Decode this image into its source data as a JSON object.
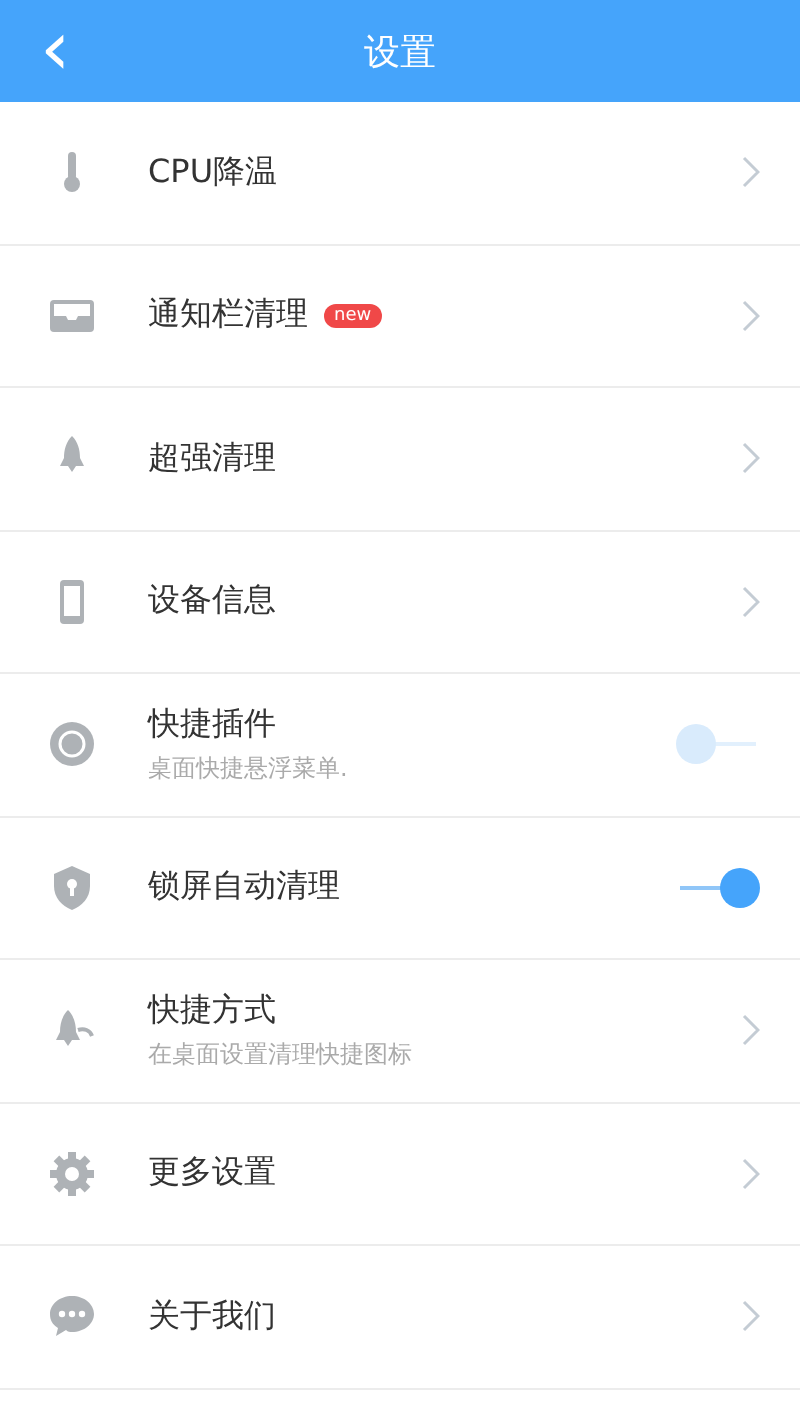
{
  "header": {
    "back": "‹",
    "title": "设置"
  },
  "items": [
    {
      "kind": "link",
      "label": "CPU降温"
    },
    {
      "kind": "link",
      "label": "通知栏清理",
      "badge": "new"
    },
    {
      "kind": "link",
      "label": "超强清理"
    },
    {
      "kind": "link",
      "label": "设备信息"
    },
    {
      "kind": "toggle",
      "label": "快捷插件",
      "subtitle": "桌面快捷悬浮菜单.",
      "on": false
    },
    {
      "kind": "toggle",
      "label": "锁屏自动清理",
      "on": true
    },
    {
      "kind": "link",
      "label": "快捷方式",
      "subtitle": "在桌面设置清理快捷图标"
    },
    {
      "kind": "link",
      "label": "更多设置"
    },
    {
      "kind": "link",
      "label": "关于我们"
    }
  ]
}
